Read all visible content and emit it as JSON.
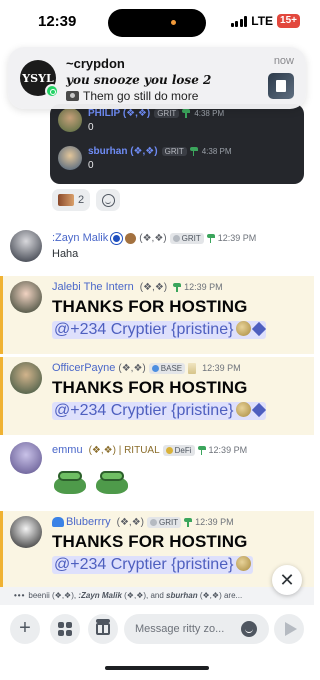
{
  "status_bar": {
    "time": "12:39",
    "network": "LTE",
    "battery": "15+"
  },
  "notification": {
    "app_icon_text": "YSYL",
    "sender": "~crypdon",
    "chat_name": "you snooze you lose 2",
    "preview": "Them go still do more",
    "time": "now"
  },
  "poll_card": {
    "rows": [
      {
        "name": "PHILIP (❖,❖)",
        "badge": "GRIT",
        "time": "4:38 PM",
        "count": "0"
      },
      {
        "name": "sburhan (❖,❖)",
        "badge": "GRIT",
        "time": "4:38 PM",
        "count": "0"
      }
    ]
  },
  "reactions": {
    "count": "2"
  },
  "messages": [
    {
      "username": ":Zayn Malik",
      "role": "(❖,❖)",
      "badge": "GRIT",
      "time": "12:39 PM",
      "text": "Haha"
    },
    {
      "username": "Jalebi The Intern",
      "role": "(❖,❖)",
      "time": "12:39 PM",
      "text": "THANKS FOR HOSTING",
      "mention": "@+234 Cryptier {pristine}"
    },
    {
      "username": "OfficerPayne",
      "role": "(❖,❖)",
      "badge": "BASE",
      "time": "12:39 PM",
      "text": "THANKS FOR HOSTING",
      "mention": "@+234 Cryptier {pristine}"
    },
    {
      "username": "emmu",
      "role": "(❖,❖) | RITUAL",
      "badge": "DeFi",
      "time": "12:39 PM"
    },
    {
      "username": "Bluberrry",
      "role": "(❖,❖)",
      "badge": "GRIT",
      "time": "12:39 PM",
      "text": "THANKS FOR HOSTING",
      "mention": "@+234 Cryptier {pristine}"
    }
  ],
  "typing": {
    "prefix": "beenii (❖,❖), ",
    "bold_name": ":Zayn Malik",
    "middle": " (❖,❖), and ",
    "bold_name2": "sburhan",
    "suffix": " (❖,❖) are..."
  },
  "input": {
    "placeholder": "Message ritty zo..."
  },
  "colors": {
    "mention_bar": "#f0b232",
    "mention_bg": "#faf5e3",
    "username_blue": "#4a67c9",
    "mention_pill_bg": "#dee0fc"
  },
  "icons": [
    "signal-bars-icon",
    "battery-icon",
    "whatsapp-icon",
    "camera-icon",
    "sprout-icon",
    "smile-icon",
    "close-icon",
    "plus-icon",
    "apps-icon",
    "gift-icon",
    "emoji-icon",
    "send-icon"
  ]
}
